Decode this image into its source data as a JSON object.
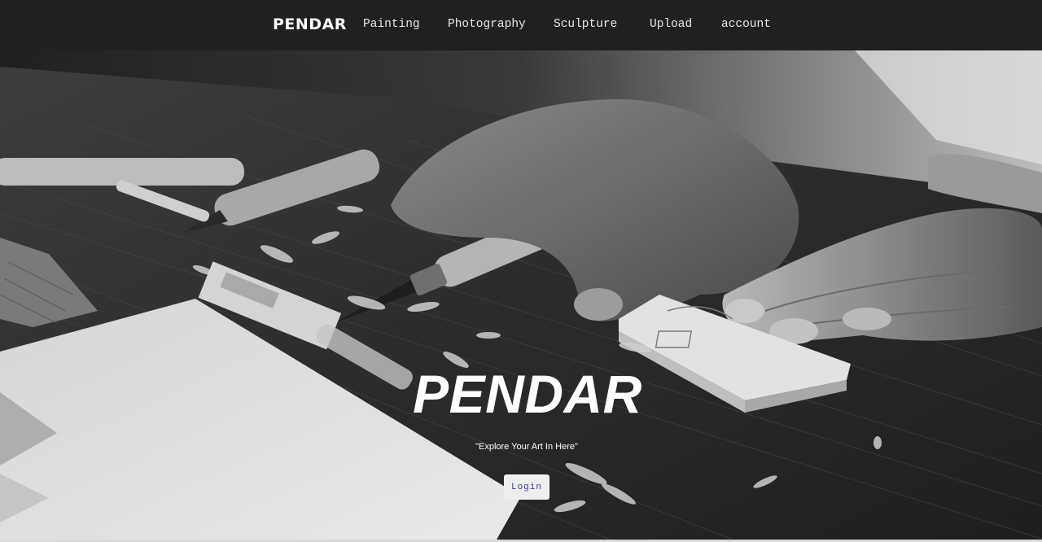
{
  "nav": {
    "brand": "PENDAR",
    "links": [
      "Painting",
      "Photography",
      "Sculpture",
      "Upload",
      "account"
    ]
  },
  "hero": {
    "title": "PENDAR",
    "tagline": "\"Explore Your Art In Here\"",
    "login_label": "Login",
    "background_description_icon": "wood-carving-photo"
  },
  "colors": {
    "navbar": "#202020",
    "text_light": "#ffffff",
    "button_bg": "#eeeeee",
    "button_text": "#3a3aa0"
  }
}
